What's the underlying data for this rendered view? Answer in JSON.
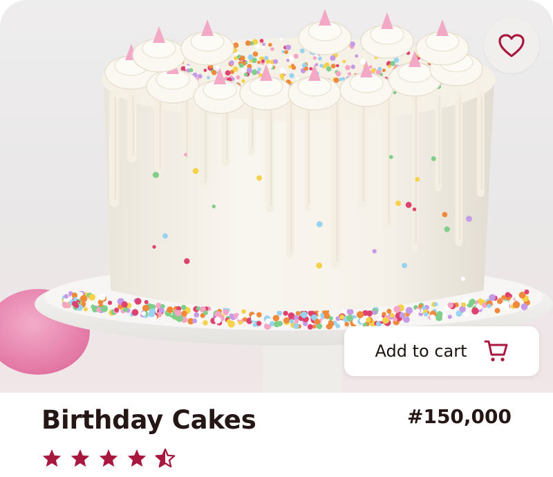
{
  "product": {
    "title": "Birthday Cakes",
    "price": "#150,000",
    "rating": 4.5,
    "rating_max": 5
  },
  "actions": {
    "add_to_cart_label": "Add to cart",
    "add_to_cart_icon": "shopping-cart-icon",
    "favorite_icon": "heart-icon"
  },
  "colors": {
    "accent": "#a8173e",
    "title_text": "#241716",
    "favorite_bg": "#f1efee"
  }
}
